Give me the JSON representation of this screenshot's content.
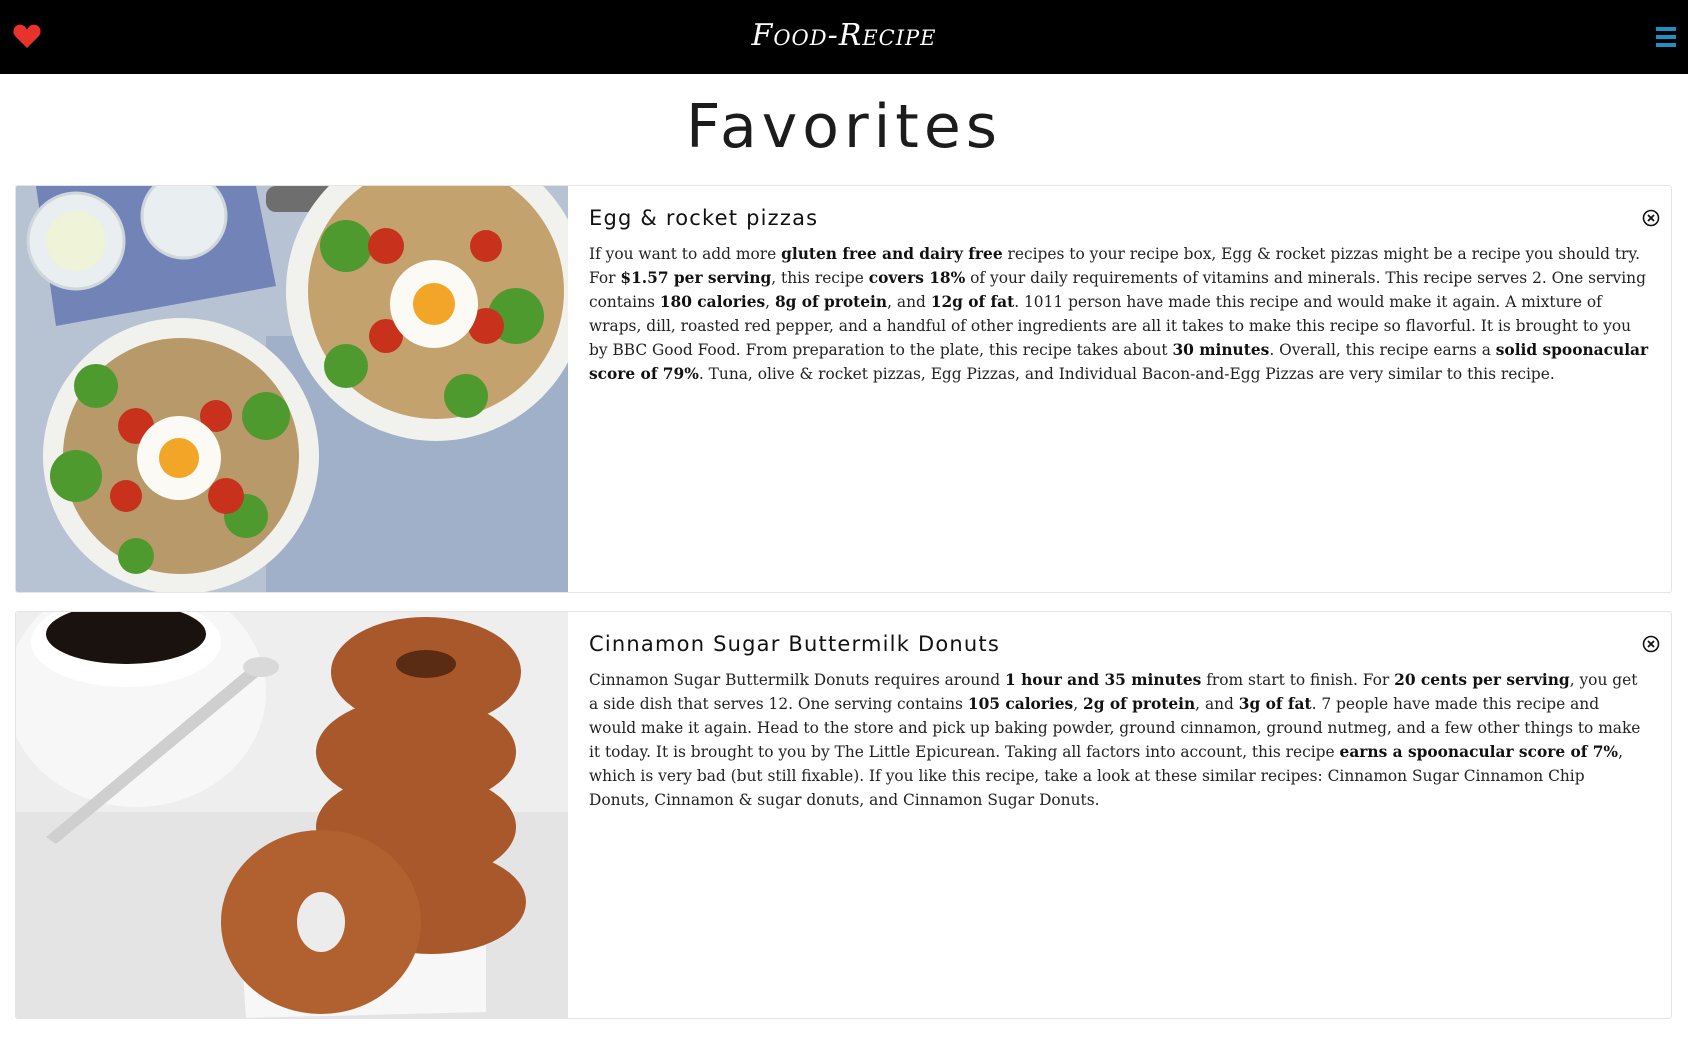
{
  "header": {
    "brand": "Food-Recipe",
    "favorites_icon": "heart-icon",
    "menu_icon": "hamburger-menu-icon",
    "heart_color": "#e8322c",
    "menu_color": "#1f8fc4"
  },
  "page": {
    "title": "Favorites"
  },
  "recipes": [
    {
      "title": "Egg & rocket pizzas",
      "remove_icon": "close-circle-icon",
      "summary": [
        {
          "t": "If you want to add more "
        },
        {
          "t": "gluten free and dairy free",
          "b": true
        },
        {
          "t": " recipes to your recipe box, Egg & rocket pizzas might be a recipe you should try. For "
        },
        {
          "t": "$1.57 per serving",
          "b": true
        },
        {
          "t": ", this recipe "
        },
        {
          "t": "covers 18%",
          "b": true
        },
        {
          "t": " of your daily requirements of vitamins and minerals. This recipe serves 2. One serving contains "
        },
        {
          "t": "180 calories",
          "b": true
        },
        {
          "t": ", "
        },
        {
          "t": "8g of protein",
          "b": true
        },
        {
          "t": ", and "
        },
        {
          "t": "12g of fat",
          "b": true
        },
        {
          "t": ". 1011 person have made this recipe and would make it again. A mixture of wraps, dill, roasted red pepper, and a handful of other ingredients are all it takes to make this recipe so flavorful. It is brought to you by BBC Good Food. From preparation to the plate, this recipe takes about "
        },
        {
          "t": "30 minutes",
          "b": true
        },
        {
          "t": ". Overall, this recipe earns a "
        },
        {
          "t": "solid spoonacular score of 79%",
          "b": true
        },
        {
          "t": ". Tuna, olive & rocket pizzas, Egg Pizzas, and Individual Bacon-and-Egg Pizzas are very similar to this recipe."
        }
      ]
    },
    {
      "title": "Cinnamon Sugar Buttermilk Donuts",
      "remove_icon": "close-circle-icon",
      "summary": [
        {
          "t": "Cinnamon Sugar Buttermilk Donuts requires around "
        },
        {
          "t": "1 hour and 35 minutes",
          "b": true
        },
        {
          "t": " from start to finish. For "
        },
        {
          "t": "20 cents per serving",
          "b": true
        },
        {
          "t": ", you get a side dish that serves 12. One serving contains "
        },
        {
          "t": "105 calories",
          "b": true
        },
        {
          "t": ", "
        },
        {
          "t": "2g of protein",
          "b": true
        },
        {
          "t": ", and "
        },
        {
          "t": "3g of fat",
          "b": true
        },
        {
          "t": ". 7 people have made this recipe and would make it again. Head to the store and pick up baking powder, ground cinnamon, ground nutmeg, and a few other things to make it today. It is brought to you by The Little Epicurean. Taking all factors into account, this recipe "
        },
        {
          "t": "earns a spoonacular score of 7%",
          "b": true
        },
        {
          "t": ", which is very bad (but still fixable). If you like this recipe, take a look at these similar recipes: Cinnamon Sugar Cinnamon Chip Donuts, Cinnamon & sugar donuts, and Cinnamon Sugar Donuts."
        }
      ]
    }
  ]
}
